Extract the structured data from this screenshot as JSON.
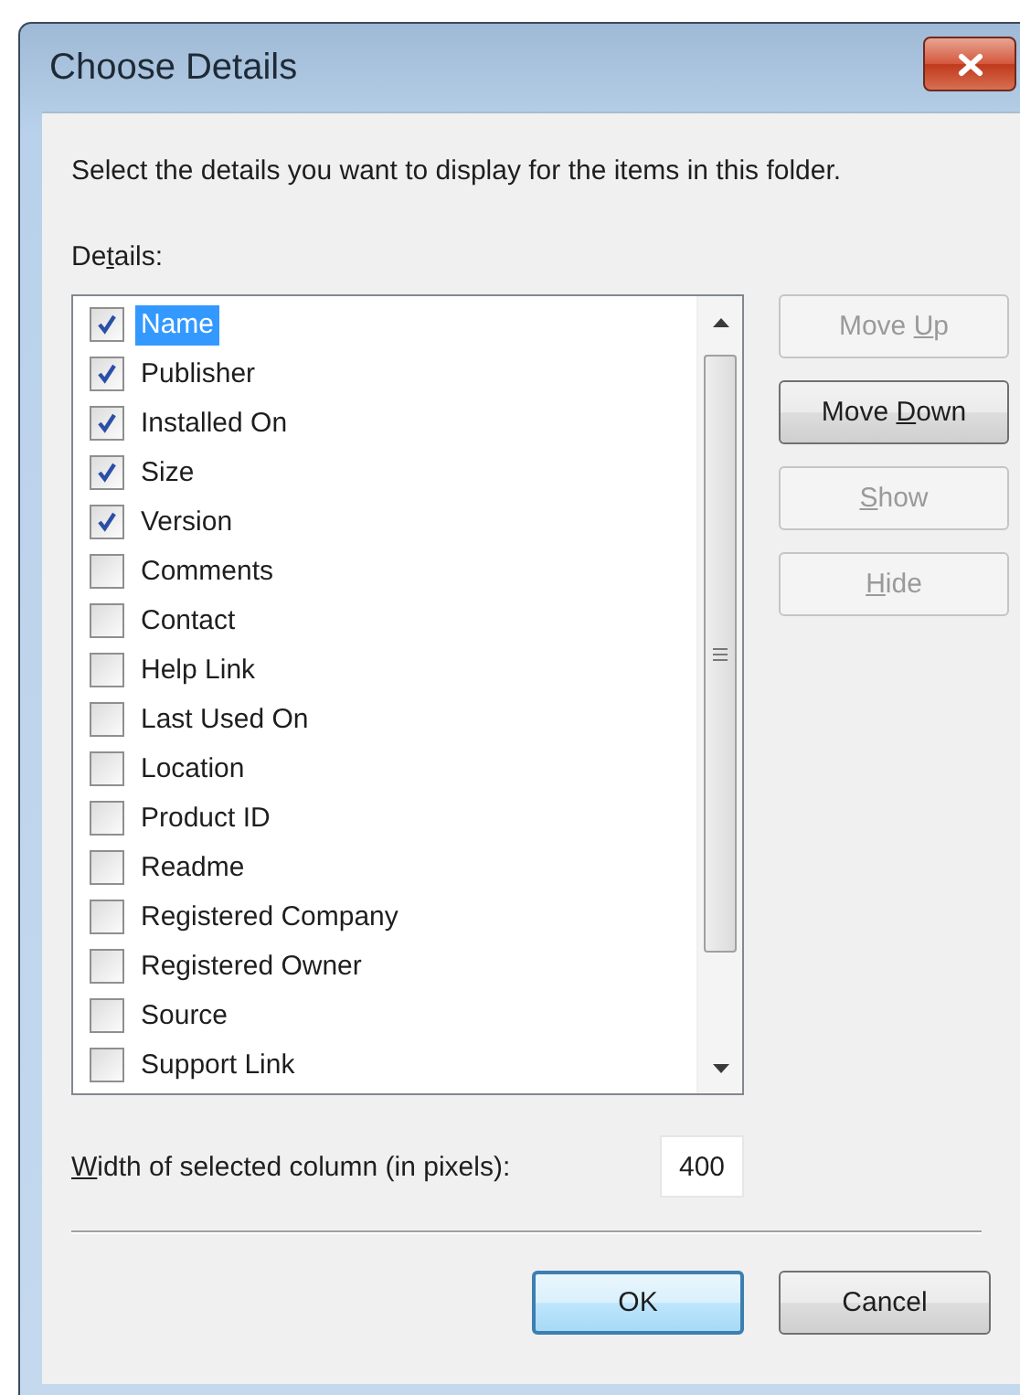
{
  "window": {
    "title": "Choose Details"
  },
  "instructions": "Select the details you want to display for the items in this folder.",
  "details_label": {
    "text_before": "De",
    "access_key": "t",
    "text_after": "ails:"
  },
  "details": [
    {
      "label": "Name",
      "checked": true,
      "selected": true
    },
    {
      "label": "Publisher",
      "checked": true,
      "selected": false
    },
    {
      "label": "Installed On",
      "checked": true,
      "selected": false
    },
    {
      "label": "Size",
      "checked": true,
      "selected": false
    },
    {
      "label": "Version",
      "checked": true,
      "selected": false
    },
    {
      "label": "Comments",
      "checked": false,
      "selected": false
    },
    {
      "label": "Contact",
      "checked": false,
      "selected": false
    },
    {
      "label": "Help Link",
      "checked": false,
      "selected": false
    },
    {
      "label": "Last Used On",
      "checked": false,
      "selected": false
    },
    {
      "label": "Location",
      "checked": false,
      "selected": false
    },
    {
      "label": "Product ID",
      "checked": false,
      "selected": false
    },
    {
      "label": "Readme",
      "checked": false,
      "selected": false
    },
    {
      "label": "Registered Company",
      "checked": false,
      "selected": false
    },
    {
      "label": "Registered Owner",
      "checked": false,
      "selected": false
    },
    {
      "label": "Source",
      "checked": false,
      "selected": false
    },
    {
      "label": "Support Link",
      "checked": false,
      "selected": false
    }
  ],
  "side_buttons": [
    {
      "text_before": "Move ",
      "access_key": "U",
      "text_after": "p",
      "disabled": true
    },
    {
      "text_before": "Move ",
      "access_key": "D",
      "text_after": "own",
      "disabled": false
    },
    {
      "access_key": "S",
      "text_after": "how",
      "disabled": true
    },
    {
      "access_key": "H",
      "text_after": "ide",
      "disabled": true
    }
  ],
  "width_field": {
    "access_key": "W",
    "text_after": "idth of selected column (in pixels):",
    "value": "400"
  },
  "footer_buttons": [
    {
      "label": "OK",
      "default": true
    },
    {
      "label": "Cancel",
      "default": false
    }
  ]
}
